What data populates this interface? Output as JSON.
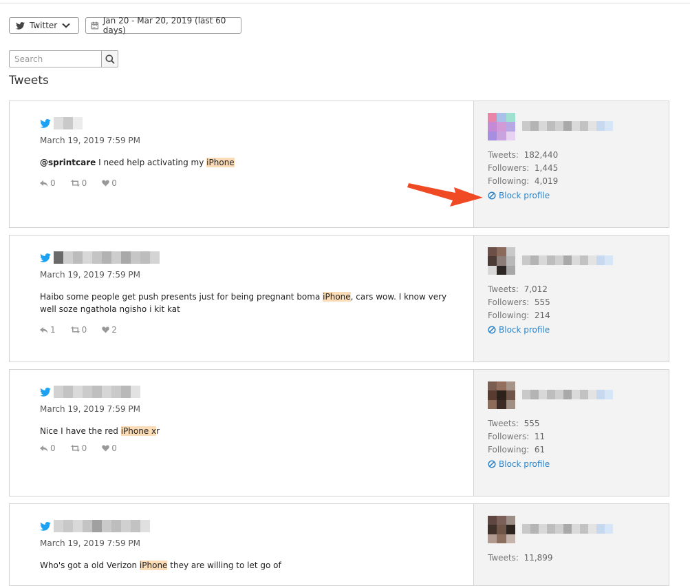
{
  "toolbar": {
    "network_label": "Twitter",
    "date_range_label": "Jan 20 - Mar 20, 2019 (last 60 days)"
  },
  "search": {
    "placeholder": "Search",
    "value": ""
  },
  "section_title": "Tweets",
  "labels": {
    "tweets": "Tweets:",
    "followers": "Followers:",
    "following": "Following:",
    "block_profile": "Block profile"
  },
  "colors": {
    "accent": "#2d83c6",
    "highlight": "#fbdcb7",
    "twitter": "#1da1f2",
    "arrow": "#f04a25"
  },
  "tweets": [
    {
      "date": "March 19, 2019 7:59 PM",
      "mention": "@sprintcare",
      "pre": " I need help activating my ",
      "hl": "iPhone",
      "post": "",
      "replies": "0",
      "retweets": "0",
      "likes": "0",
      "stats": {
        "tweets": "182,440",
        "followers": "1,445",
        "following": "4,019"
      }
    },
    {
      "date": "March 19, 2019 7:59 PM",
      "mention": "",
      "pre": "Haibo some people get push presents just for being pregnant boma ",
      "hl": "iPhone",
      "post": ", cars wow. I know very well soze ngathola ngisho i kit kat",
      "replies": "1",
      "retweets": "0",
      "likes": "2",
      "stats": {
        "tweets": "7,012",
        "followers": "555",
        "following": "214"
      }
    },
    {
      "date": "March 19, 2019 7:59 PM",
      "mention": "",
      "pre": "Nice I have the red ",
      "hl": "iPhone x",
      "post": "r",
      "replies": "0",
      "retweets": "0",
      "likes": "0",
      "stats": {
        "tweets": "555",
        "followers": "11",
        "following": "61"
      }
    },
    {
      "date": "March 19, 2019 7:59 PM",
      "mention": "",
      "pre": "Who's got a old Verizon ",
      "hl": "iPhone",
      "post": " they are willing to let go of",
      "replies": "",
      "retweets": "",
      "likes": "",
      "stats": {
        "tweets": "11,899",
        "followers": "",
        "following": ""
      }
    }
  ]
}
